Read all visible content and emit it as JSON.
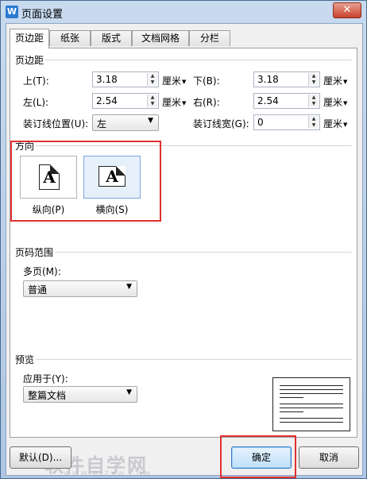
{
  "window": {
    "title": "页面设置",
    "app_icon_letter": "W",
    "close_symbol": "✕"
  },
  "tabs": [
    {
      "label": "页边距",
      "active": true
    },
    {
      "label": "纸张",
      "active": false
    },
    {
      "label": "版式",
      "active": false
    },
    {
      "label": "文档网格",
      "active": false
    },
    {
      "label": "分栏",
      "active": false
    }
  ],
  "margins": {
    "section_title": "页边距",
    "top": {
      "label": "上(T):",
      "value": "3.18",
      "unit": "厘米"
    },
    "bottom": {
      "label": "下(B):",
      "value": "3.18",
      "unit": "厘米"
    },
    "left": {
      "label": "左(L):",
      "value": "2.54",
      "unit": "厘米"
    },
    "right": {
      "label": "右(R):",
      "value": "2.54",
      "unit": "厘米"
    },
    "gutter_position": {
      "label": "装订线位置(U):",
      "value": "左"
    },
    "gutter_width": {
      "label": "装订线宽(G):",
      "value": "0",
      "unit": "厘米"
    }
  },
  "orientation": {
    "section_title": "方向",
    "portrait": {
      "label": "纵向(P)",
      "glyph": "A"
    },
    "landscape": {
      "label": "横向(S)",
      "glyph": "A"
    },
    "selected": "landscape"
  },
  "pages": {
    "section_title": "页码范围",
    "multiple_label": "多页(M):",
    "multiple_value": "普通"
  },
  "preview": {
    "section_title": "预览",
    "apply_to_label": "应用于(Y):",
    "apply_to_value": "整篇文档"
  },
  "buttons": {
    "default": "默认(D)...",
    "ok": "确定",
    "cancel": "取消"
  },
  "watermark": {
    "text": "软件自学网",
    "sub": "WWW.RJZXW.COM"
  },
  "colors": {
    "highlight_box": "#e0312f",
    "selected_orientation": "#7aa7db"
  }
}
